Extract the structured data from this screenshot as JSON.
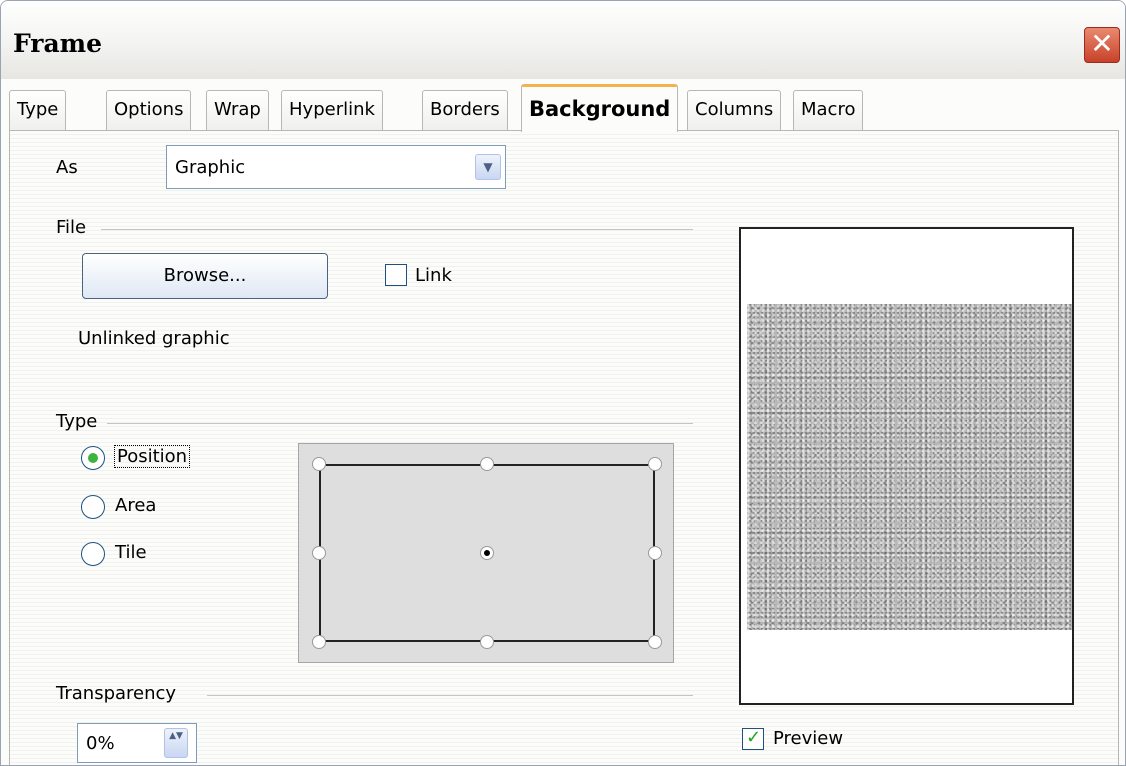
{
  "window": {
    "title": "Frame",
    "close_glyph": "✕"
  },
  "tabs": [
    {
      "label": "Type"
    },
    {
      "label": "Options"
    },
    {
      "label": "Wrap"
    },
    {
      "label": "Hyperlink"
    },
    {
      "label": "Borders"
    },
    {
      "label": "Background",
      "active": true
    },
    {
      "label": "Columns"
    },
    {
      "label": "Macro"
    }
  ],
  "as_field": {
    "label": "As",
    "value": "Graphic",
    "arrow_glyph": "▼"
  },
  "file_section": {
    "title": "File",
    "browse_label": "Browse...",
    "link_label": "Link",
    "link_checked": false,
    "status": "Unlinked graphic"
  },
  "type_section": {
    "title": "Type",
    "options": [
      {
        "label": "Position",
        "checked": true
      },
      {
        "label": "Area",
        "checked": false
      },
      {
        "label": "Tile",
        "checked": false
      }
    ],
    "selected_position": "center"
  },
  "transparency": {
    "label": "Transparency",
    "value": "0%",
    "arrows_glyph": "▲▼"
  },
  "preview": {
    "label": "Preview",
    "checked": true
  },
  "colors": {
    "active_tab_accent": "#f4b350",
    "close_button": "#c8412a",
    "check_green": "#21a121"
  }
}
